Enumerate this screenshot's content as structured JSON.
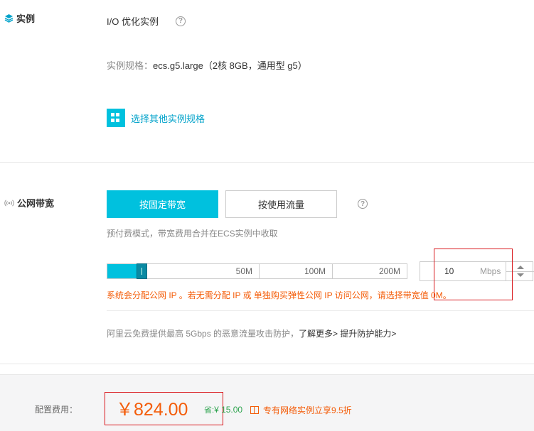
{
  "instance": {
    "section_label": "实例",
    "title": "I/O 优化实例",
    "spec_prefix": "实例规格：",
    "spec_value": "ecs.g5.large（2核 8GB，通用型 g5）",
    "choose_other": "选择其他实例规格"
  },
  "bandwidth": {
    "section_label": "公网带宽",
    "mode_fixed": "按固定带宽",
    "mode_usage": "按使用流量",
    "billing_note": "预付费模式，带宽费用合并在ECS实例中收取",
    "slider": {
      "marks": [
        "50M",
        "100M",
        "200M"
      ],
      "value_fraction": 0.13
    },
    "input": {
      "value": "10",
      "unit": "Mbps"
    },
    "warning": "系统会分配公网 IP 。若无需分配 IP 或 单独购买弹性公网 IP 访问公网，请选择带宽值 0M。",
    "protection": {
      "text": "阿里云免费提供最高 5Gbps 的恶意流量攻击防护，",
      "learn_more": "了解更多>",
      "upgrade": "提升防护能力>"
    }
  },
  "footer": {
    "fee_label": "配置费用：",
    "price": "￥824.00",
    "save_label": "省:",
    "save_value": "¥ 15.00",
    "promo": "专有网络实例立享9.5折"
  },
  "colors": {
    "accent": "#00c1de",
    "link": "#00a2ca",
    "warning": "#f45d0a",
    "highlight_box": "#d9191e",
    "save_green": "#2ea44f"
  }
}
